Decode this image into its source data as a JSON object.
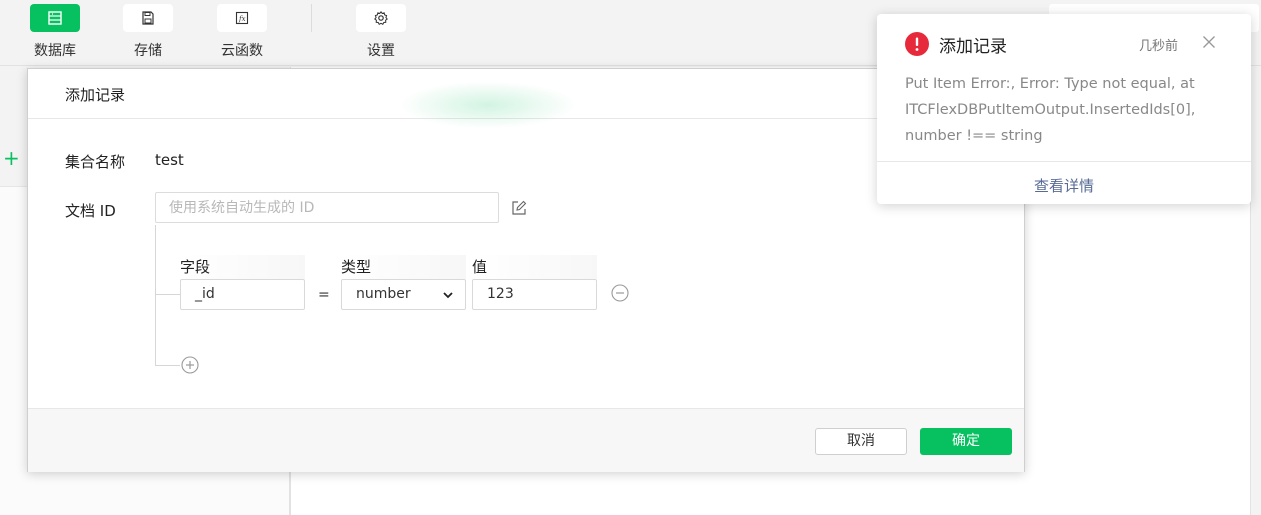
{
  "toolbar": {
    "items": [
      {
        "label": "数据库",
        "icon": "database-icon",
        "active": true
      },
      {
        "label": "存储",
        "icon": "save-icon",
        "active": false
      },
      {
        "label": "云函数",
        "icon": "function-icon",
        "active": false
      },
      {
        "label": "设置",
        "icon": "gear-icon",
        "active": false
      }
    ]
  },
  "dialog": {
    "title": "添加记录",
    "collection_label": "集合名称",
    "collection_value": "test",
    "docid_label": "文档 ID",
    "docid_placeholder": "使用系统自动生成的 ID",
    "docid_value": "",
    "columns": {
      "field": "字段",
      "type": "类型",
      "value": "值"
    },
    "rows": [
      {
        "field": "_id",
        "operator": "=",
        "type": "number",
        "value": "123"
      }
    ],
    "cancel_label": "取消",
    "confirm_label": "确定"
  },
  "toast": {
    "title": "添加记录",
    "time": "几秒前",
    "message": "Put Item Error:, Error: Type not equal, at ITCFlexDBPutItemOutput.InsertedIds[0], number !== string",
    "link": "查看详情"
  },
  "colors": {
    "accent": "#07c160",
    "error": "#e62a3b",
    "link": "#576b95"
  }
}
